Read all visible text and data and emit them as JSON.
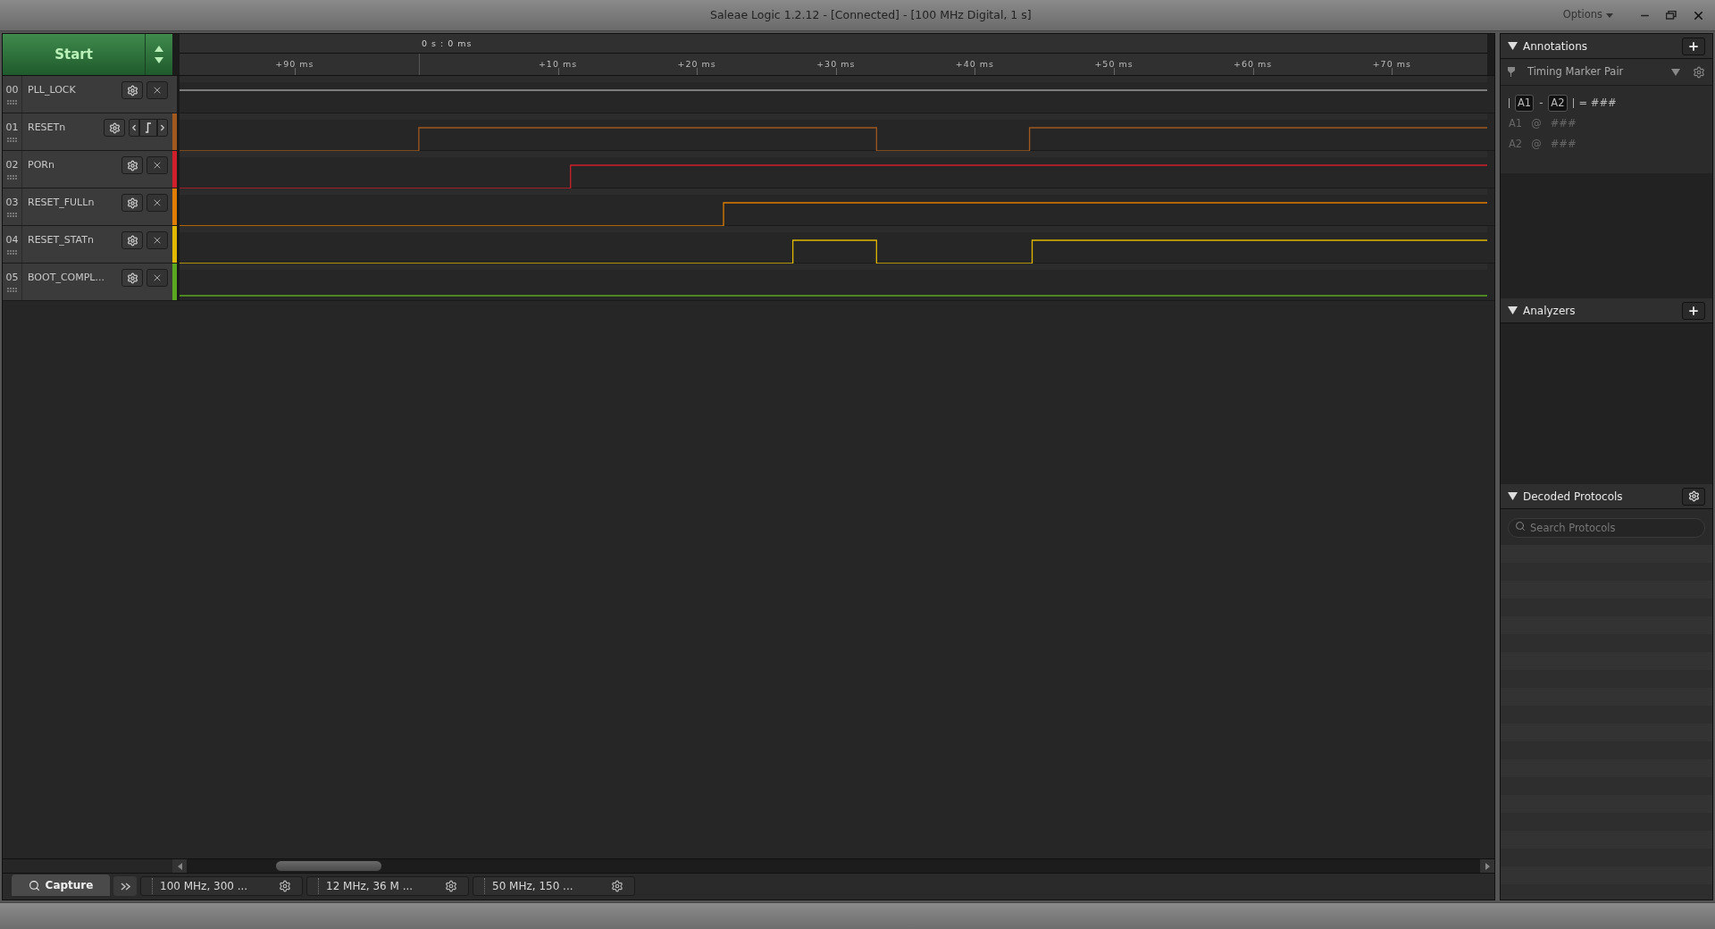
{
  "window": {
    "title": "Saleae Logic 1.2.12 - [Connected] - [100 MHz Digital, 1 s]",
    "options": "Options"
  },
  "start_button": {
    "label": "Start"
  },
  "ruler": {
    "origin": "0 s : 0 ms",
    "ticks": [
      "+90 ms",
      "+10 ms",
      "+20 ms",
      "+30 ms",
      "+40 ms",
      "+50 ms",
      "+60 ms",
      "+70 ms"
    ]
  },
  "channels": [
    {
      "number": "00",
      "name": "PLL_LOCK",
      "color": "#3c3c3c",
      "kind": "close"
    },
    {
      "number": "01",
      "name": "RESETn",
      "color": "#a0581f",
      "kind": "edge-nav"
    },
    {
      "number": "02",
      "name": "PORn",
      "color": "#d01f2a",
      "kind": "close"
    },
    {
      "number": "03",
      "name": "RESET_FULLn",
      "color": "#e07d00",
      "kind": "close"
    },
    {
      "number": "04",
      "name": "RESET_STATn",
      "color": "#e0b800",
      "kind": "close"
    },
    {
      "number": "05",
      "name": "BOOT_COMPL...",
      "color": "#5aa820",
      "kind": "close"
    }
  ],
  "bottom_tabs": {
    "capture": "Capture",
    "sessions": [
      {
        "label": "100 MHz, 300 ..."
      },
      {
        "label": "12 MHz, 36 M ..."
      },
      {
        "label": "50 MHz, 150 ..."
      }
    ]
  },
  "annotations": {
    "title": "Annotations",
    "marker_type": "Timing Marker Pair",
    "formula": {
      "a1": "A1",
      "dash": "-",
      "a2": "A2",
      "result": "= ###"
    },
    "markers": [
      {
        "name": "A1",
        "at": "@",
        "value": "###"
      },
      {
        "name": "A2",
        "at": "@",
        "value": "###"
      }
    ]
  },
  "analyzers": {
    "title": "Analyzers"
  },
  "decoded_protocols": {
    "title": "Decoded Protocols",
    "search": {
      "placeholder": "Search Protocols"
    }
  }
}
